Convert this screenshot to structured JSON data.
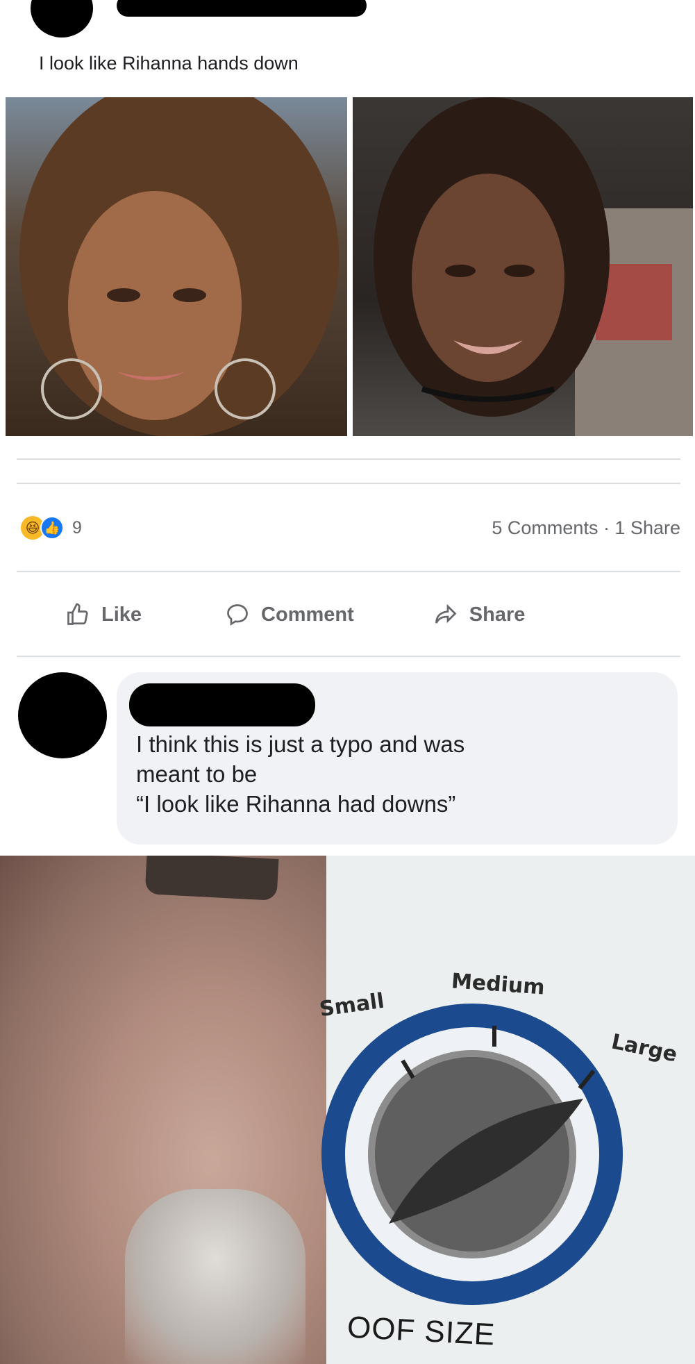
{
  "post": {
    "caption": "I look like Rihanna hands down",
    "photos": [
      {
        "name": "photo-left"
      },
      {
        "name": "photo-right"
      }
    ]
  },
  "reactions": {
    "count": "9",
    "comments_shares": "5 Comments · 1 Share"
  },
  "actions": {
    "like_label": "Like",
    "comment_label": "Comment",
    "share_label": "Share"
  },
  "comment": {
    "text": "I think this is just a typo and was\nmeant to be\n“I look like Rihanna had downs”"
  },
  "meme": {
    "dial_labels": {
      "small": "Small",
      "medium": "Medium",
      "large": "Large"
    },
    "caption": "OOF SIZE"
  },
  "colors": {
    "link_blue": "#1877f2",
    "haha_yellow": "#f7b928",
    "dial_blue": "#1b4a8f",
    "muted_text": "#65676b"
  }
}
